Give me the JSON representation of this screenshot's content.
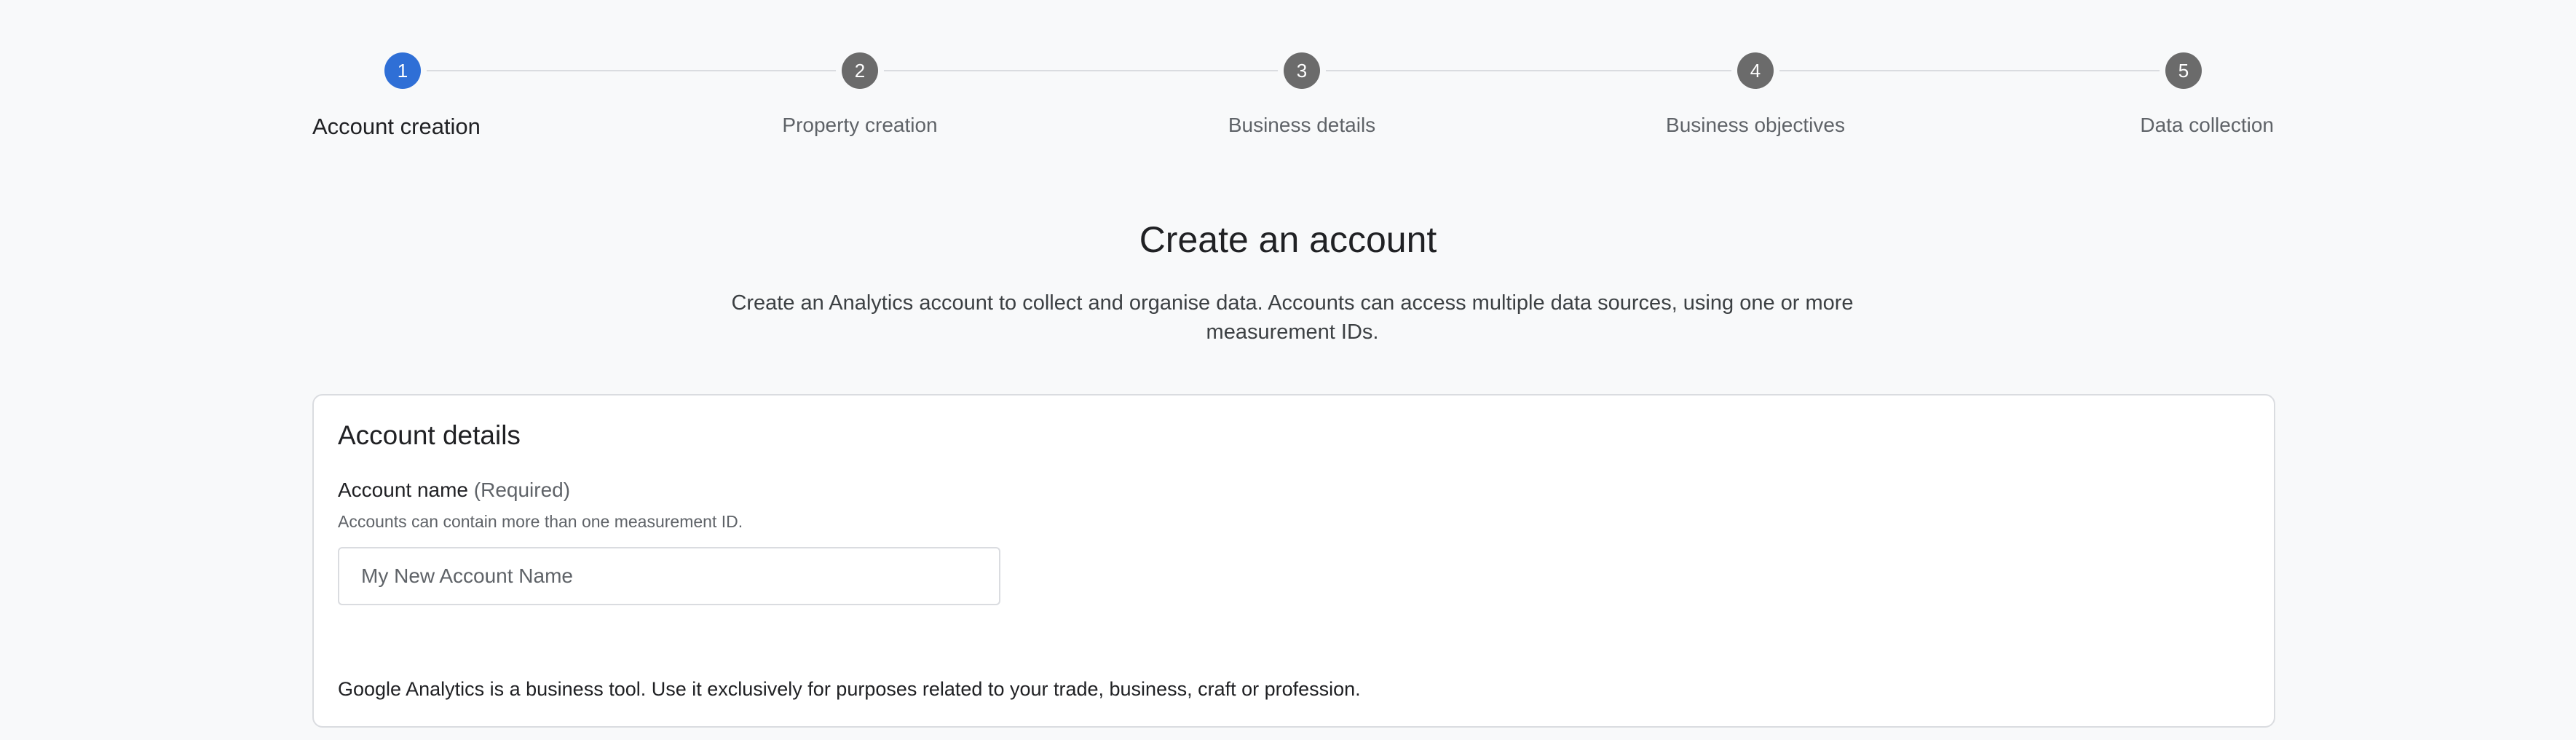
{
  "stepper": {
    "steps": [
      {
        "number": "1",
        "label": "Account creation",
        "state": "active"
      },
      {
        "number": "2",
        "label": "Property creation",
        "state": "inactive"
      },
      {
        "number": "3",
        "label": "Business details",
        "state": "inactive"
      },
      {
        "number": "4",
        "label": "Business objectives",
        "state": "inactive"
      },
      {
        "number": "5",
        "label": "Data collection",
        "state": "inactive"
      }
    ]
  },
  "header": {
    "title": "Create an account",
    "subtitle": "Create an Analytics account to collect and organise data. Accounts can access multiple data sources, using one or more measurement IDs."
  },
  "account_details": {
    "title": "Account details",
    "account_name": {
      "label": "Account name",
      "required_text": "(Required)",
      "help": "Accounts can contain more than one measurement ID.",
      "value": "",
      "placeholder": "My New Account Name"
    },
    "footnote": "Google Analytics is a business tool. Use it exclusively for purposes related to your trade, business, craft or profession."
  },
  "colors": {
    "active_step": "#2f6fd6",
    "inactive_step": "#6b6b6b",
    "background": "#f8f9fa"
  }
}
